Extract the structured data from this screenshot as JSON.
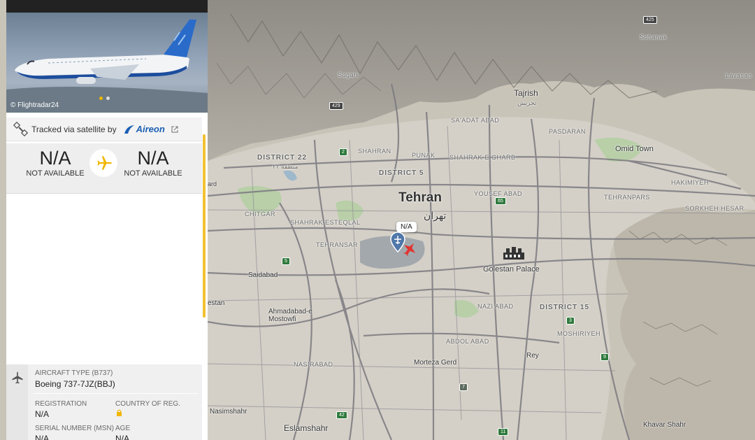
{
  "photo": {
    "credit": "© Flightradar24"
  },
  "tracking": {
    "text": "Tracked via satellite by",
    "provider": "Aireon"
  },
  "route": {
    "origin_code": "N/A",
    "origin_city": "NOT AVAILABLE",
    "destination_code": "N/A",
    "destination_city": "NOT AVAILABLE"
  },
  "details": {
    "aircraft_type_label": "AIRCRAFT TYPE (B737)",
    "aircraft_type_value": "Boeing 737-7JZ(BBJ)",
    "registration_label": "REGISTRATION",
    "registration_value": "N/A",
    "country_label": "COUNTRY OF REG.",
    "serial_label": "SERIAL NUMBER (MSN)",
    "serial_value": "N/A",
    "age_label": "AGE",
    "age_value": "N/A"
  },
  "map": {
    "marker_label": "N/A",
    "labels": {
      "tehran": "Tehran",
      "tehran_fa": "تهران",
      "tajrish": "Tajrish",
      "tajrish_fa": "تجریش",
      "golestan": "Golestan Palace",
      "district22": "DISTRICT 22",
      "district22_fa": "منطقه ۲۲",
      "district5": "DISTRICT 5",
      "district15": "DISTRICT 15",
      "saadat_abad": "SA'ADAT ABAD",
      "shahran": "SHAHRAN",
      "punak": "PUNAK",
      "shahrak_gharb": "SHAHRAK-E GHARB",
      "yousef_abad": "YOUSEF ABAD",
      "pasdaran": "PASDARAN",
      "omid_town": "Omid Town",
      "hakimiyeh": "HAKIMIYEH",
      "tehranpars": "TEHRANPARS",
      "sorkheh_hesar": "SORKHEH HESAR",
      "chitgar": "CHITGAR",
      "shahrak_esteqlal": "SHAHRAK ESTEQLAL",
      "tehransar": "TEHRANSAR",
      "saidabad": "Saidabad",
      "ahmadabad": "Ahmadabad-e Mostowfi",
      "nazi_abad": "NAZI ABAD",
      "abdol_abad": "ABDOL ABAD",
      "moshiriyeh": "MOSHIRIYEH",
      "morteza_gerd": "Morteza Gerd",
      "nasirabad": "NASIRABAD",
      "rey": "Rey",
      "nasimshahr": "Nasimshahr",
      "eslamshahr": "Eslamshahr",
      "khavar_shahr": "Khavar Shahr",
      "sohanak": "Sohanak",
      "sugari": "Sugari",
      "lavasan": "Lavasan",
      "estan": "estan",
      "ard": "ard"
    },
    "shields": {
      "r425": "425",
      "r429": "429",
      "r2": "2",
      "r5": "5",
      "r7": "7",
      "r65": "65",
      "r3": "3",
      "r9": "9",
      "r42": "42",
      "r11": "11"
    }
  }
}
